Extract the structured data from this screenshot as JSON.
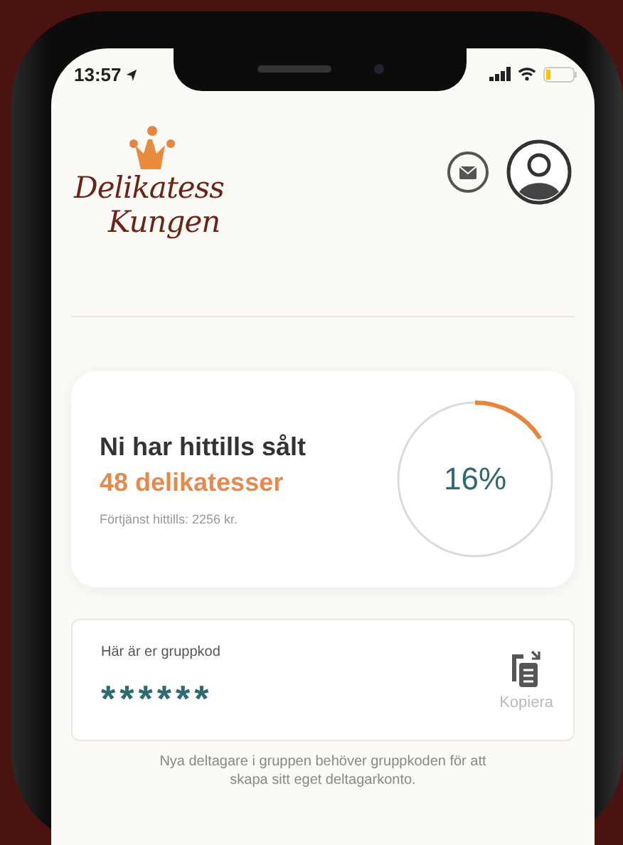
{
  "status_bar": {
    "time": "13:57"
  },
  "logo": {
    "line_1": "Delikatess",
    "line_2": "Kungen"
  },
  "sales_card": {
    "title": "Ni har hittills sålt",
    "count": "48 delikatesser",
    "earnings": "Förtjänst hittills: 2256 kr.",
    "progress": {
      "level": 0.16,
      "reading": "16%"
    }
  },
  "group_code_card": {
    "label": "Här är er gruppkod",
    "code": "******",
    "copy_button": "Kopiera"
  },
  "note": "Nya deltagare i gruppen behöver gruppkoden för att skapa sitt eget deltagarkonto."
}
